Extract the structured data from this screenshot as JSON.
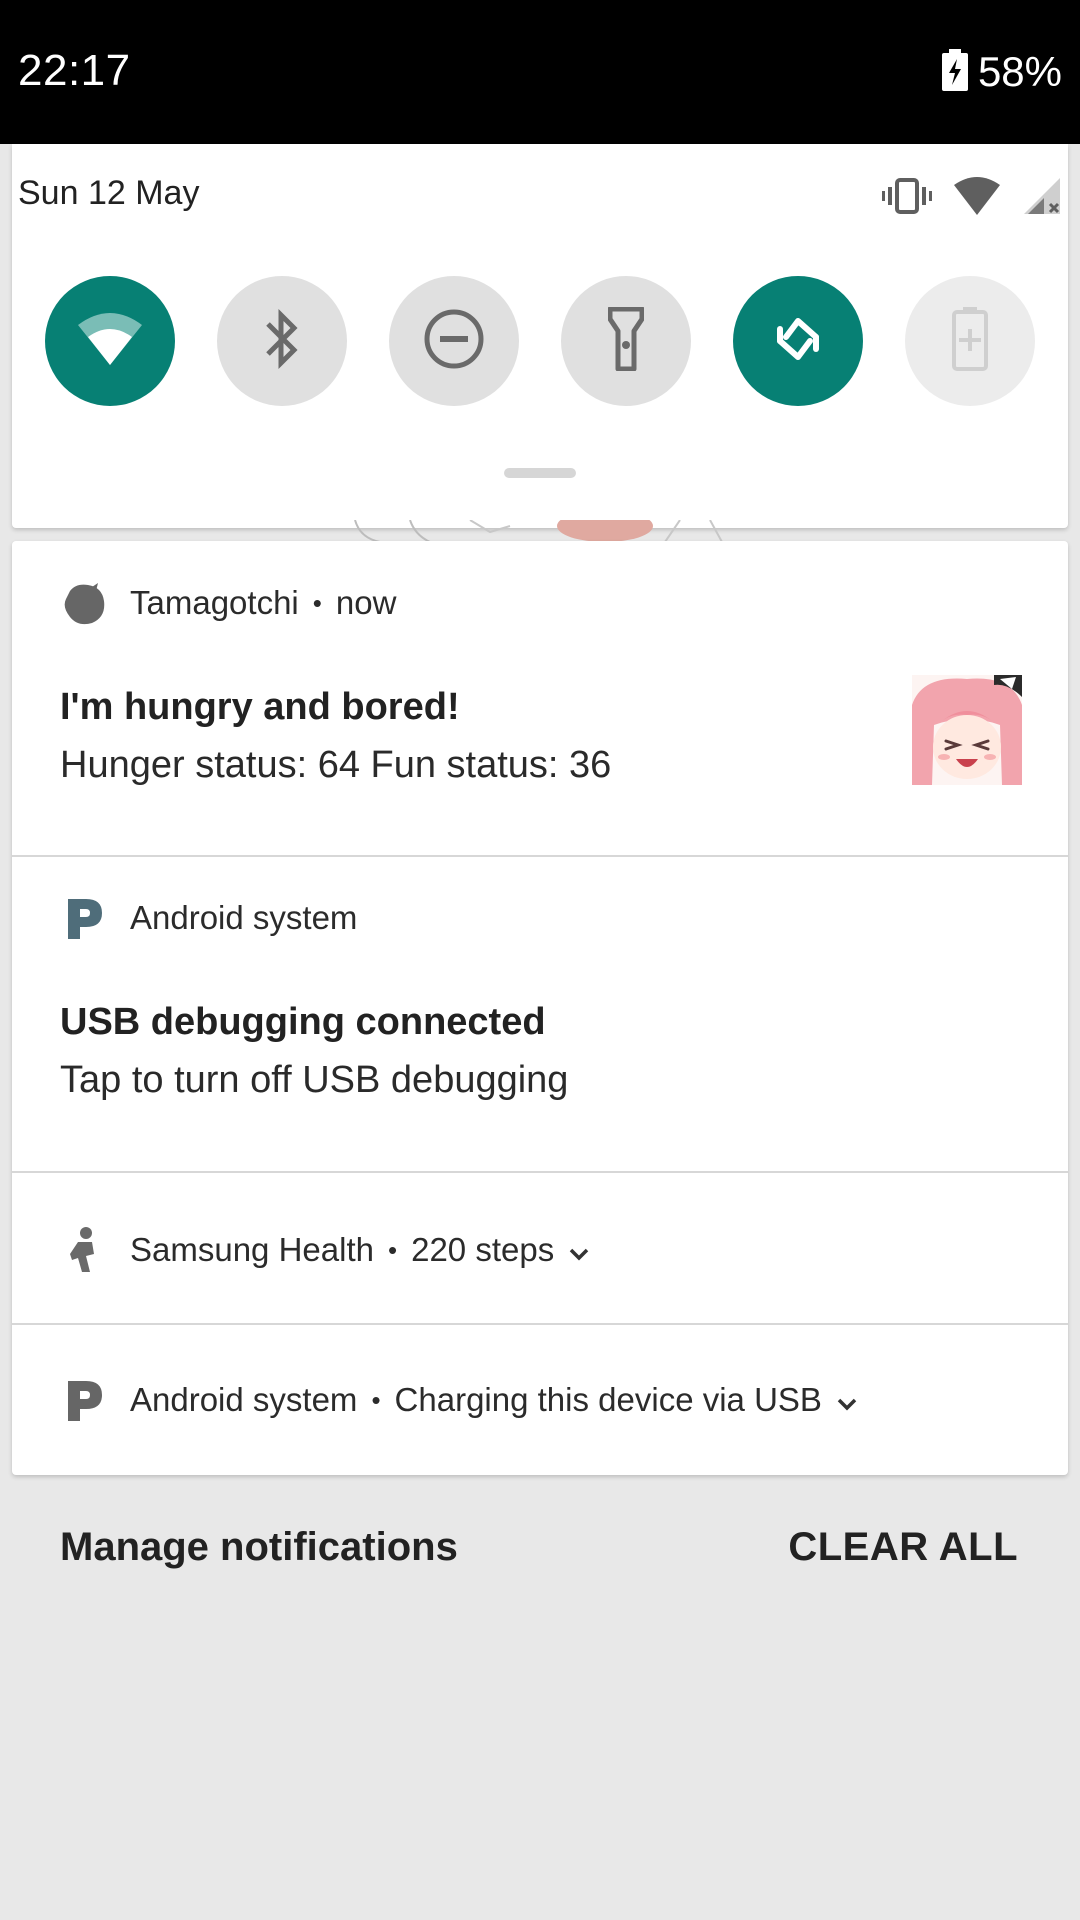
{
  "status_bar": {
    "time": "22:17",
    "battery_percent": "58%"
  },
  "quick_settings": {
    "date": "Sun 12 May",
    "tiles": [
      {
        "name": "wifi",
        "state": "on",
        "icon": "wifi-icon"
      },
      {
        "name": "bluetooth",
        "state": "off",
        "icon": "bluetooth-icon"
      },
      {
        "name": "do-not-disturb",
        "state": "off",
        "icon": "dnd-icon"
      },
      {
        "name": "flashlight",
        "state": "off",
        "icon": "flashlight-icon"
      },
      {
        "name": "auto-rotate",
        "state": "on",
        "icon": "rotate-icon"
      },
      {
        "name": "battery-saver",
        "state": "disabled",
        "icon": "battery-saver-icon"
      }
    ],
    "colors": {
      "tile_on": "#078074",
      "tile_off": "#e0e0e0"
    }
  },
  "notifications": [
    {
      "app": "Tamagotchi",
      "time": "now",
      "title": "I'm hungry and bored!",
      "text": "Hunger status: 64 Fun status: 36",
      "icon": "tamagotchi-icon"
    },
    {
      "app": "Android system",
      "title": "USB debugging connected",
      "text": "Tap to turn off USB debugging",
      "icon": "android-system-icon"
    },
    {
      "app": "Samsung Health",
      "summary": "220 steps",
      "icon": "samsung-health-icon"
    },
    {
      "app": "Android system",
      "summary": "Charging this device via USB",
      "icon": "android-system-icon"
    }
  ],
  "footer": {
    "manage": "Manage notifications",
    "clear_all": "CLEAR ALL"
  }
}
